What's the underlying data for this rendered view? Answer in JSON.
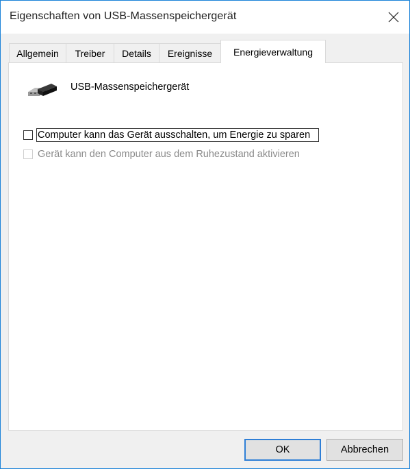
{
  "window": {
    "title": "Eigenschaften von USB-Massenspeichergerät",
    "close_icon": "close-icon"
  },
  "tabs": [
    {
      "label": "Allgemein",
      "active": false
    },
    {
      "label": "Treiber",
      "active": false
    },
    {
      "label": "Details",
      "active": false
    },
    {
      "label": "Ereignisse",
      "active": false
    },
    {
      "label": "Energieverwaltung",
      "active": true
    }
  ],
  "device": {
    "icon": "usb-connector-icon",
    "name": "USB-Massenspeichergerät"
  },
  "options": [
    {
      "label": "Computer kann das Gerät ausschalten, um Energie zu sparen",
      "checked": false,
      "enabled": true,
      "focused": true
    },
    {
      "label": "Gerät kann den Computer aus dem Ruhezustand aktivieren",
      "checked": false,
      "enabled": false,
      "focused": false
    }
  ],
  "buttons": {
    "ok": "OK",
    "cancel": "Abbrechen"
  },
  "colors": {
    "accent": "#2f7fd6",
    "window_border": "#1a82d8",
    "disabled_text": "#8a8a8a"
  }
}
